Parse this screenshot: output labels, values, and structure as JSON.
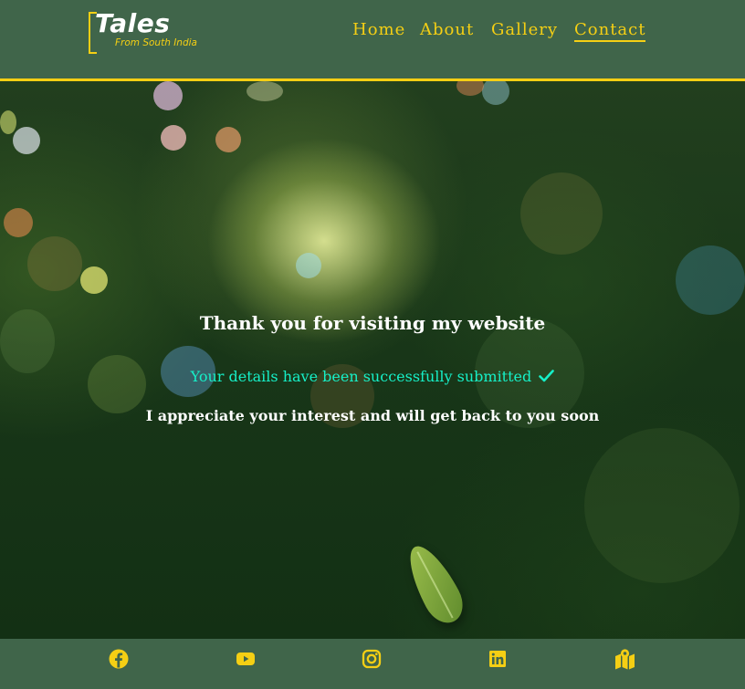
{
  "brand": {
    "title": "Tales",
    "subtitle": "From South India"
  },
  "nav": {
    "items": [
      {
        "label": "Home"
      },
      {
        "label": "About"
      },
      {
        "label": "Gallery"
      },
      {
        "label": "Contact",
        "active": true
      }
    ]
  },
  "message": {
    "heading": "Thank you for visiting my website",
    "success": "Your details have been successfully submitted",
    "followup": "I appreciate your interest and will get back to you soon"
  },
  "footer": {
    "icons": [
      "facebook-icon",
      "youtube-icon",
      "instagram-icon",
      "linkedin-icon",
      "map-icon"
    ]
  },
  "colors": {
    "header_bg": "#40654a",
    "accent": "#f5cf14",
    "success_text": "#16f0c8",
    "text": "#ffffff"
  }
}
